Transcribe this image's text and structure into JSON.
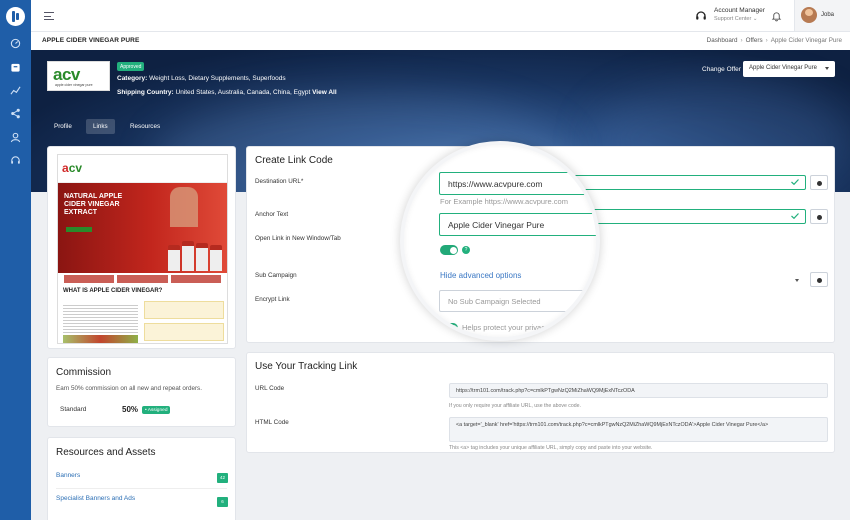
{
  "topbar": {
    "account_title": "Account Manager",
    "account_subtitle": "Support Center",
    "user_name": "Joba"
  },
  "page": {
    "title": "APPLE CIDER VINEGAR PURE",
    "breadcrumb": [
      "Dashboard",
      "Offers",
      "Apple Cider Vinegar Pure"
    ]
  },
  "offer": {
    "logo_text": "acv",
    "logo_subtext": "apple cider vinegar pure",
    "status_badge": "Approved",
    "category_label": "Category:",
    "category_value": "Weight Loss, Dietary Supplements, Superfoods",
    "shipping_label": "Shipping Country:",
    "shipping_value": "United States, Australia, Canada, China, Egypt",
    "view_all": "View All",
    "change_offer_label": "Change Offer",
    "change_offer_value": "Apple Cider Vinegar Pure"
  },
  "tabs": [
    "Profile",
    "Links",
    "Resources"
  ],
  "preview": {
    "hero_text": "NATURAL APPLE CIDER VINEGAR EXTRACT",
    "section_title": "WHAT IS APPLE CIDER VINEGAR?"
  },
  "commission": {
    "title": "Commission",
    "description": "Earn 50% commission on all new and repeat orders.",
    "plan_label": "Standard",
    "plan_value": "50%",
    "plan_badge": "• Assigned"
  },
  "resources": {
    "title": "Resources and Assets",
    "items": [
      {
        "label": "Banners",
        "count": "42"
      },
      {
        "label": "Specialist Banners and Ads",
        "count": "6"
      }
    ]
  },
  "create_link": {
    "title": "Create Link Code",
    "destination_label": "Destination URL*",
    "destination_value": "https://www.acvpure.com",
    "destination_hint": "For Example https://www.acvpure.com",
    "anchor_label": "Anchor Text",
    "anchor_value": "Apple Cider Vinegar Pure",
    "new_window_label": "Open Link in New Window/Tab",
    "help_mark": "?",
    "advanced_toggle": "Hide advanced options",
    "sub_campaign_label": "Sub Campaign",
    "sub_campaign_placeholder": "No Sub Campaign Selected",
    "encrypt_label": "Encrypt Link",
    "encrypt_hint": "Helps protect your privacy"
  },
  "tracking": {
    "title": "Use Your Tracking Link",
    "url_label": "URL Code",
    "url_value": "https://trm101.com/track.php?c=cmlkPTgwNzQ2MiZhaWQ9MjExNTczODA",
    "url_note": "If you only require your affiliate URL, use the above code.",
    "html_label": "HTML Code",
    "html_value": "<a target='_blank' href='https://trm101.com/track.php?c=cmlkPTgwNzQ2MiZhaWQ9MjExNTczODA'>Apple Cider Vinegar Pure</a>",
    "html_note": "This <a> tag includes your unique affiliate URL, simply copy and paste into your website."
  },
  "colors": {
    "sidebar": "#1f5ea8",
    "accent_green": "#22b07d",
    "link_blue": "#3b78c4"
  }
}
